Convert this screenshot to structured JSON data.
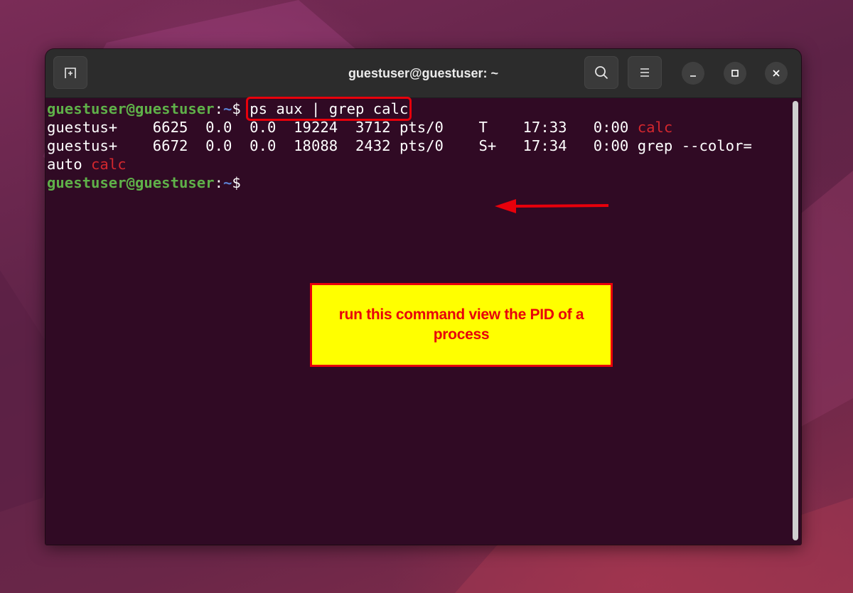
{
  "window": {
    "title": "guestuser@guestuser: ~"
  },
  "titlebar": {
    "new_tab_icon": "new-tab-icon",
    "search_icon": "search-icon",
    "menu_icon": "hamburger-menu-icon",
    "minimize_icon": "minimize-icon",
    "maximize_icon": "maximize-icon",
    "close_icon": "close-icon"
  },
  "terminal": {
    "prompt1": {
      "user": "guestuser@guestuser",
      "colon": ":",
      "path": "~",
      "symbol": "$ ",
      "command": "ps aux | grep calc"
    },
    "output": [
      {
        "text": "guestus+    6625  0.0  0.0  19224  3712 pts/0    T    17:33   0:00 ",
        "match": "calc"
      },
      {
        "text": "guestus+    6672  0.0  0.0  18088  2432 pts/0    S+   17:34   0:00 grep --color=",
        "match": ""
      },
      {
        "text": "auto ",
        "match": "calc"
      }
    ],
    "prompt2": {
      "user": "guestuser@guestuser",
      "colon": ":",
      "path": "~",
      "symbol": "$"
    }
  },
  "annotation": {
    "callout_text": "run this command view the PID of a process",
    "accent_color": "#e8000b",
    "callout_bg": "#ffff00"
  },
  "colors": {
    "terminal_bg": "#300a24",
    "prompt_user": "#5fb049",
    "prompt_path": "#5b7fd0",
    "grep_match": "#d3272e"
  }
}
